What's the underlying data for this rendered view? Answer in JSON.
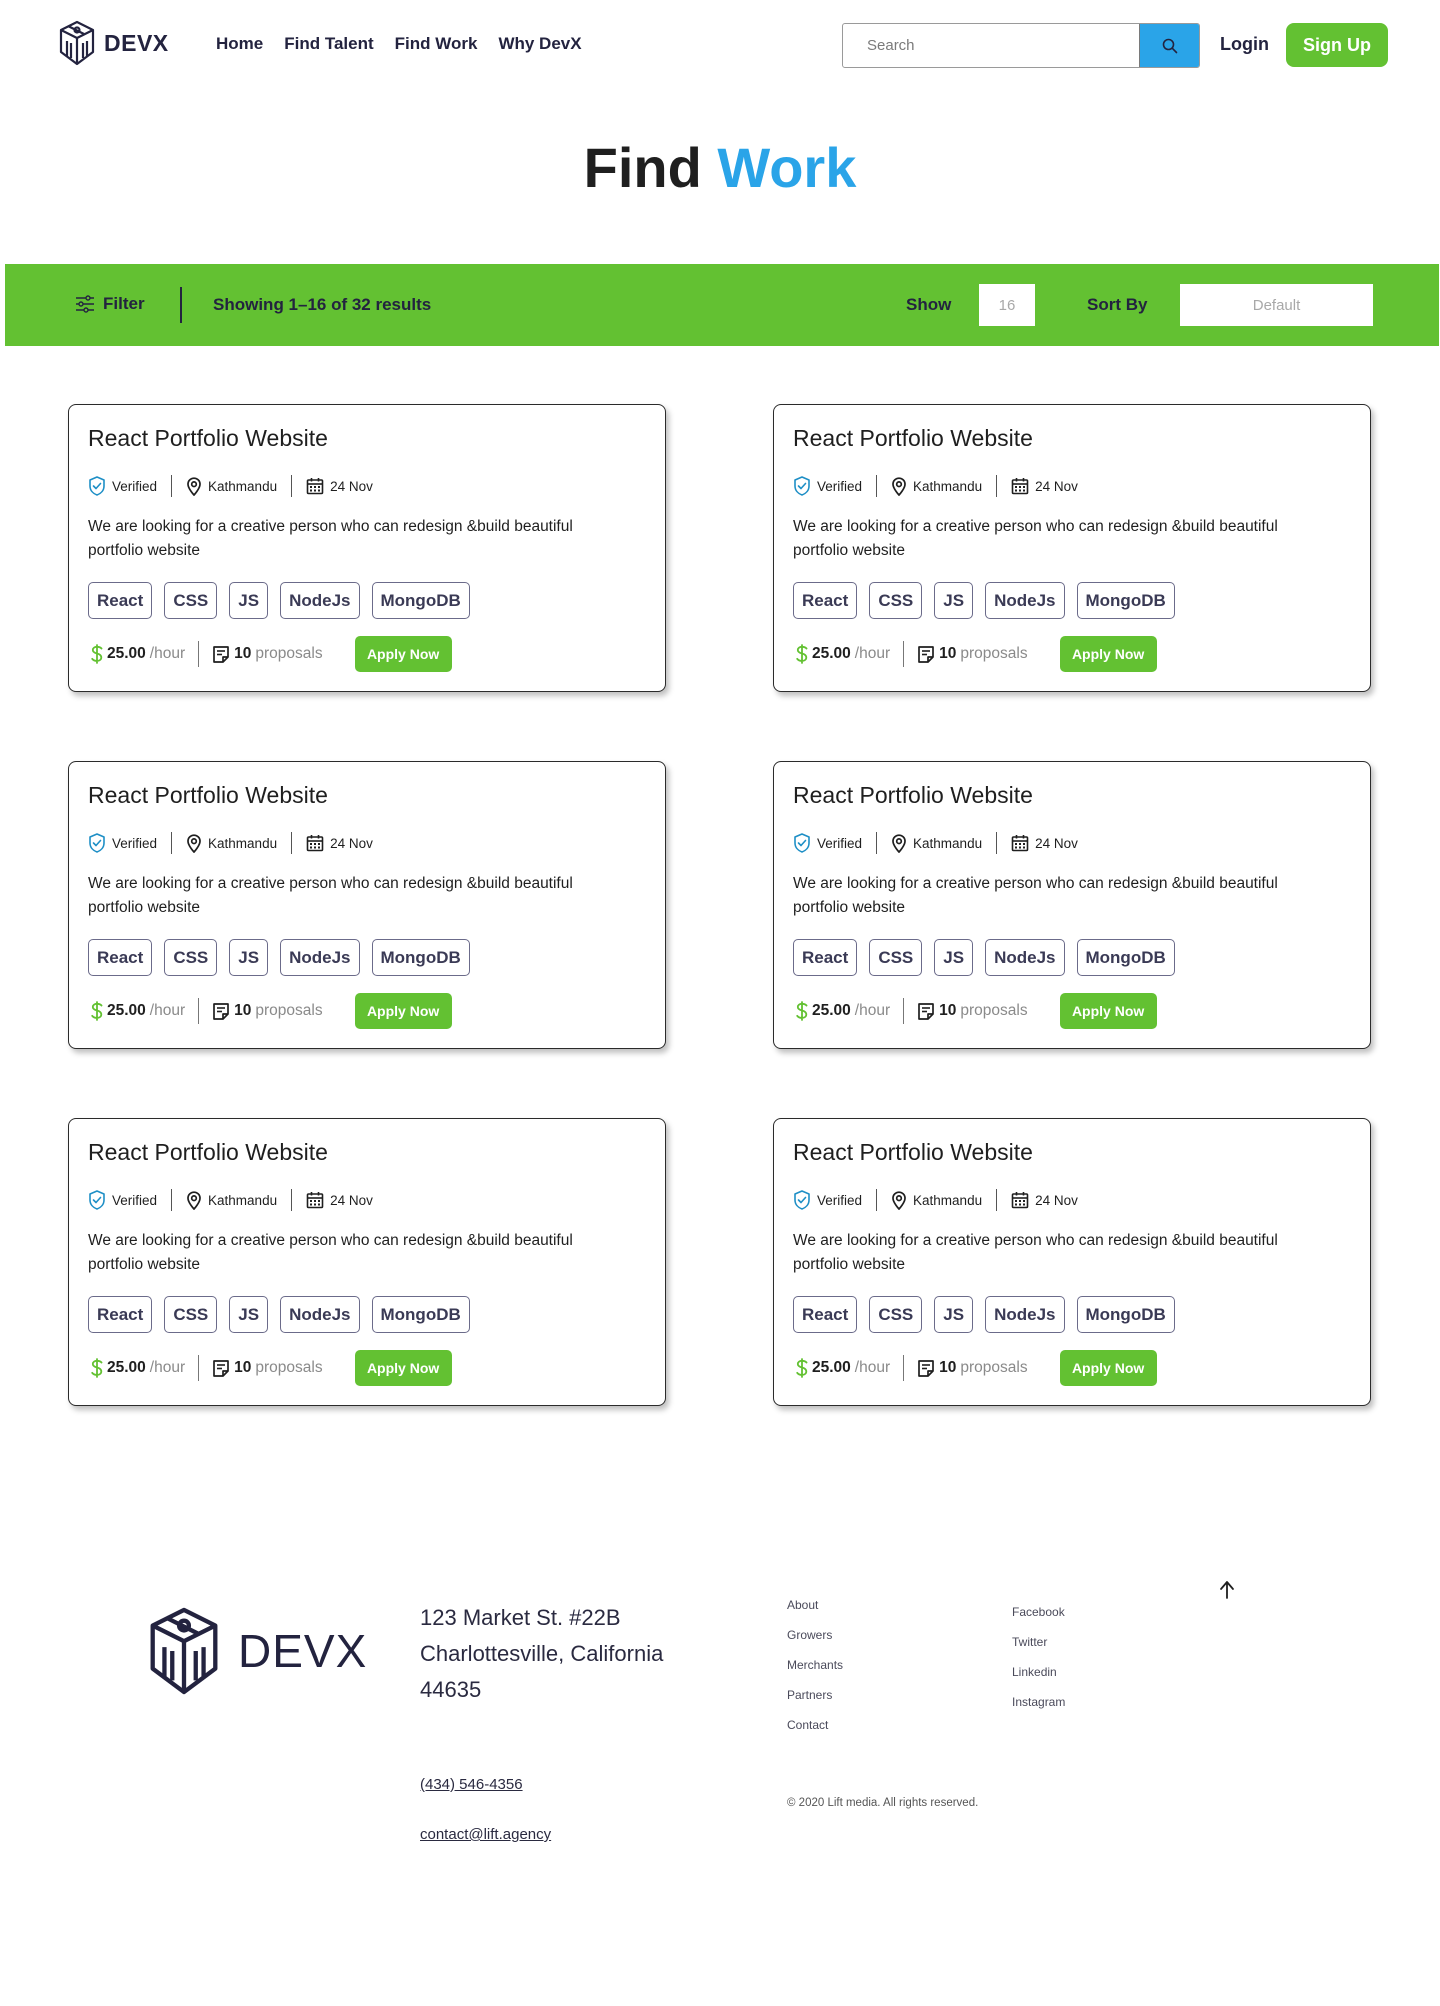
{
  "header": {
    "logo_text": "DEVX",
    "nav": [
      "Home",
      "Find Talent",
      "Find Work",
      "Why DevX"
    ],
    "search_placeholder": "Search",
    "login": "Login",
    "signup": "Sign Up"
  },
  "title": {
    "part1": "Find",
    "part2": "Work"
  },
  "filter_bar": {
    "filter_label": "Filter",
    "results_text": "Showing 1–16 of 32 results",
    "show_label": "Show",
    "show_value": "16",
    "sort_label": "Sort By",
    "sort_value": "Default"
  },
  "cards": [
    {
      "title": "React Portfolio Website",
      "verified": "Verified",
      "location": "Kathmandu",
      "date": "24 Nov",
      "description": "We are looking for a creative person who can redesign &build beautiful portfolio website",
      "tags": [
        "React",
        "CSS",
        "JS",
        "NodeJs",
        "MongoDB"
      ],
      "rate": "25.00",
      "rate_unit": "/hour",
      "proposals_count": "10",
      "proposals_label": "proposals",
      "apply": "Apply Now"
    },
    {
      "title": "React Portfolio Website",
      "verified": "Verified",
      "location": "Kathmandu",
      "date": "24 Nov",
      "description": "We are looking for a creative person who can redesign &build beautiful portfolio website",
      "tags": [
        "React",
        "CSS",
        "JS",
        "NodeJs",
        "MongoDB"
      ],
      "rate": "25.00",
      "rate_unit": "/hour",
      "proposals_count": "10",
      "proposals_label": "proposals",
      "apply": "Apply Now"
    },
    {
      "title": "React Portfolio Website",
      "verified": "Verified",
      "location": "Kathmandu",
      "date": "24 Nov",
      "description": "We are looking for a creative person who can redesign &build beautiful portfolio website",
      "tags": [
        "React",
        "CSS",
        "JS",
        "NodeJs",
        "MongoDB"
      ],
      "rate": "25.00",
      "rate_unit": "/hour",
      "proposals_count": "10",
      "proposals_label": "proposals",
      "apply": "Apply Now"
    },
    {
      "title": "React Portfolio Website",
      "verified": "Verified",
      "location": "Kathmandu",
      "date": "24 Nov",
      "description": "We are looking for a creative person who can redesign &build beautiful portfolio website",
      "tags": [
        "React",
        "CSS",
        "JS",
        "NodeJs",
        "MongoDB"
      ],
      "rate": "25.00",
      "rate_unit": "/hour",
      "proposals_count": "10",
      "proposals_label": "proposals",
      "apply": "Apply Now"
    },
    {
      "title": "React Portfolio Website",
      "verified": "Verified",
      "location": "Kathmandu",
      "date": "24 Nov",
      "description": "We are looking for a creative person who can redesign &build beautiful portfolio website",
      "tags": [
        "React",
        "CSS",
        "JS",
        "NodeJs",
        "MongoDB"
      ],
      "rate": "25.00",
      "rate_unit": "/hour",
      "proposals_count": "10",
      "proposals_label": "proposals",
      "apply": "Apply Now"
    },
    {
      "title": "React Portfolio Website",
      "verified": "Verified",
      "location": "Kathmandu",
      "date": "24 Nov",
      "description": "We are looking for a creative person who can redesign &build beautiful portfolio website",
      "tags": [
        "React",
        "CSS",
        "JS",
        "NodeJs",
        "MongoDB"
      ],
      "rate": "25.00",
      "rate_unit": "/hour",
      "proposals_count": "10",
      "proposals_label": "proposals",
      "apply": "Apply Now"
    }
  ],
  "footer": {
    "logo_text": "DEVX",
    "address_line1": "123 Market St. #22B",
    "address_line2": "Charlottesville, California",
    "address_line3": "44635",
    "phone": "(434) 546-4356",
    "email": "contact@lift.agency",
    "links_col1": [
      "About",
      "Growers",
      "Merchants",
      "Partners",
      "Contact"
    ],
    "links_col2": [
      "Facebook",
      "Twitter",
      "Linkedin",
      "Instagram"
    ],
    "copyright": "© 2020 Lift media. All rights reserved."
  }
}
